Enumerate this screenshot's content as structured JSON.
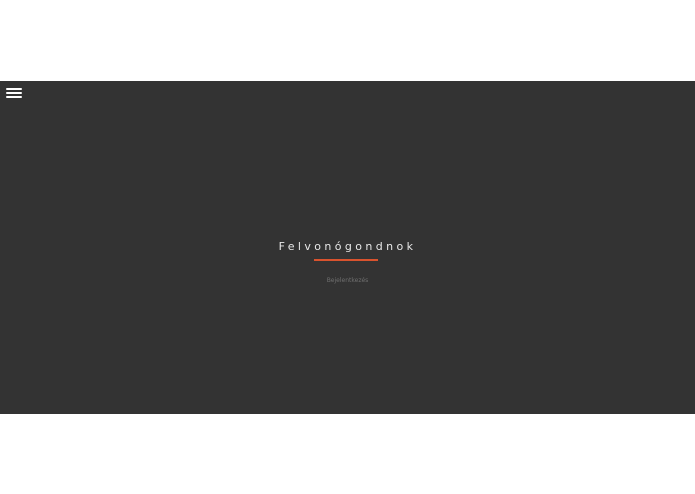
{
  "header": {
    "menu_icon": "hamburger-menu-icon"
  },
  "hero": {
    "title": "Felvonógondnok",
    "subtitle": "Bejelentkezés"
  },
  "colors": {
    "hero_background": "#333333",
    "accent": "#d9532e",
    "title_text": "#e8e8e8",
    "subtitle_text": "#6f6f6f"
  }
}
